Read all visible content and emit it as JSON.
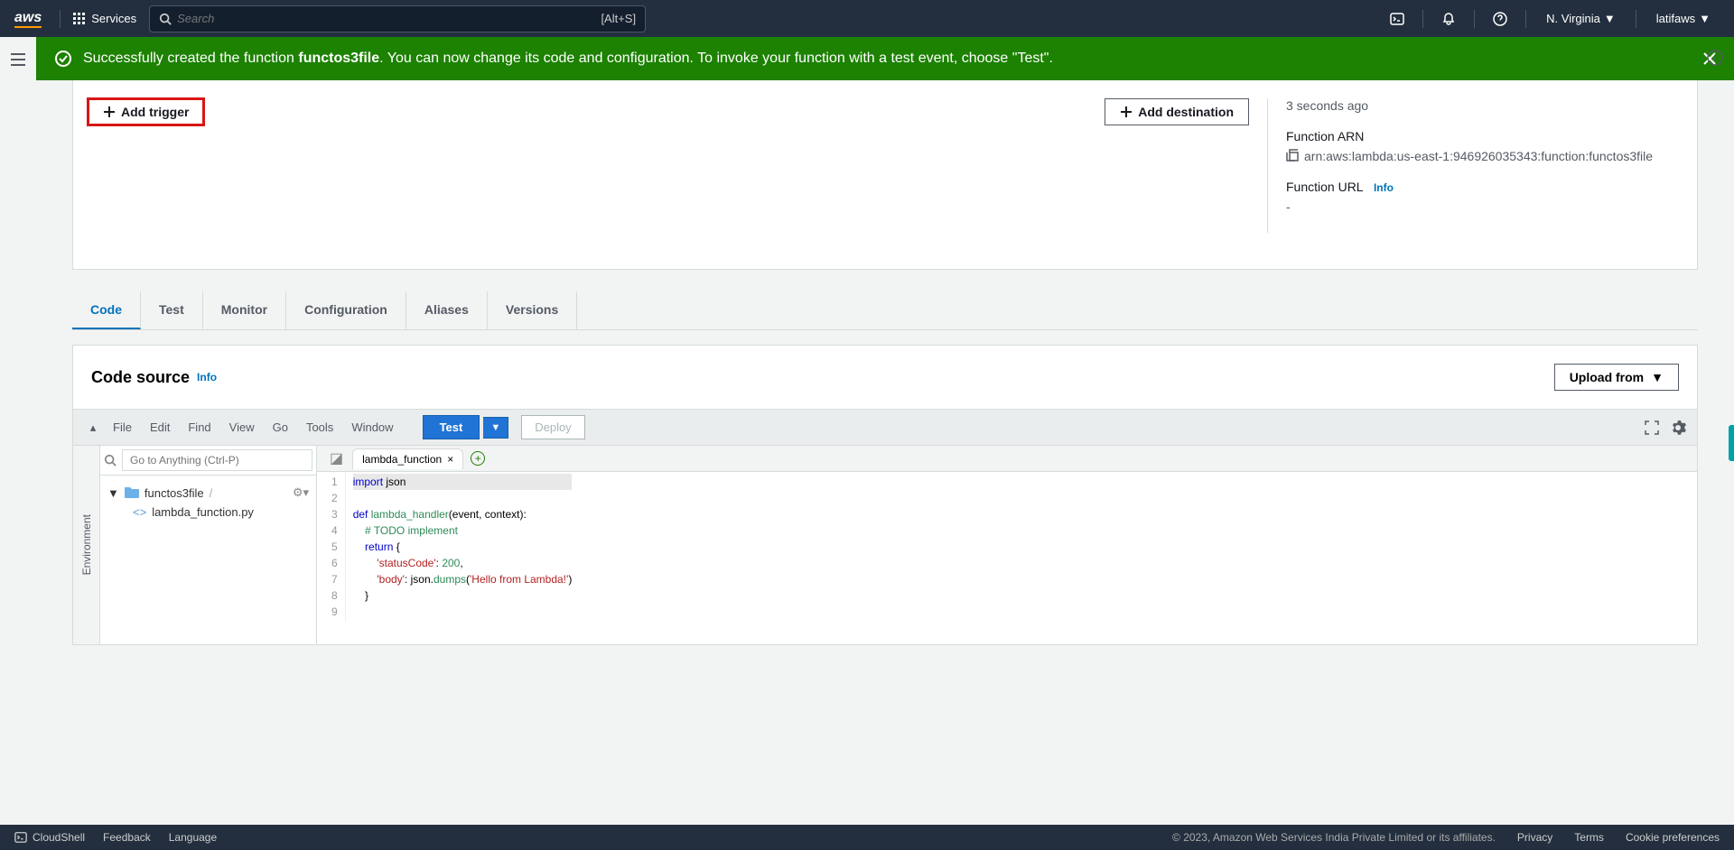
{
  "header": {
    "services_label": "Services",
    "search_placeholder": "Search",
    "search_shortcut": "[Alt+S]",
    "region": "N. Virginia",
    "user": "latifaws"
  },
  "notification": {
    "prefix": "Successfully created the function ",
    "function_name": "functos3file",
    "suffix": ". You can now change its code and configuration. To invoke your function with a test event, choose \"Test\"."
  },
  "designer": {
    "add_trigger": "Add trigger",
    "add_destination": "Add destination",
    "last_modified_value": "3 seconds ago",
    "arn_label": "Function ARN",
    "arn_value": "arn:aws:lambda:us-east-1:946926035343:function:functos3file",
    "url_label": "Function URL",
    "url_value": "-",
    "info": "Info"
  },
  "tabs": [
    "Code",
    "Test",
    "Monitor",
    "Configuration",
    "Aliases",
    "Versions"
  ],
  "code_source": {
    "title": "Code source",
    "info": "Info",
    "upload": "Upload from"
  },
  "ide": {
    "menus": [
      "File",
      "Edit",
      "Find",
      "View",
      "Go",
      "Tools",
      "Window"
    ],
    "test": "Test",
    "deploy": "Deploy",
    "goto_placeholder": "Go to Anything (Ctrl-P)",
    "env_tab": "Environment",
    "folder": "functos3file",
    "file": "lambda_function.py",
    "open_tab": "lambda_function",
    "line_numbers": [
      "1",
      "2",
      "3",
      "4",
      "5",
      "6",
      "7",
      "8",
      "9"
    ]
  },
  "footer": {
    "cloudshell": "CloudShell",
    "feedback": "Feedback",
    "language": "Language",
    "copyright": "© 2023, Amazon Web Services India Private Limited or its affiliates.",
    "privacy": "Privacy",
    "terms": "Terms",
    "cookies": "Cookie preferences"
  }
}
